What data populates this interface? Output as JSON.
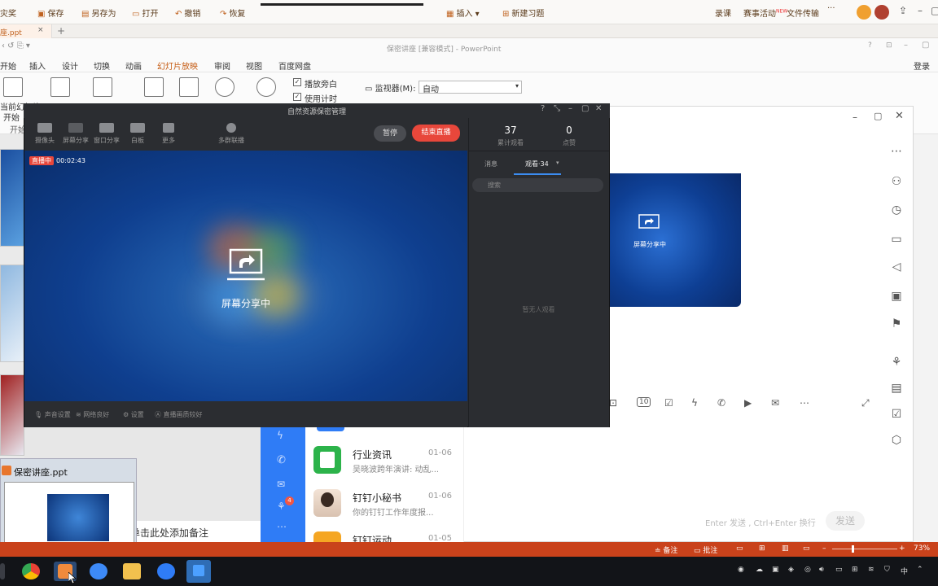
{
  "toolbar": {
    "left_cut": "灾奖",
    "save": "保存",
    "save_as": "另存为",
    "open": "打开",
    "undo": "撤销",
    "redo": "恢复",
    "insert": "插入",
    "new_exercise": "新建习题",
    "record": "录课",
    "events": "赛事活动",
    "events_badge": "NEW",
    "file_transfer": "文件传输",
    "more": "···"
  },
  "doc_tab": {
    "name": "座.ppt",
    "close": "×",
    "add": "+"
  },
  "window_title": "保密讲座 [兼容模式] - PowerPoint",
  "ribbon_tabs": [
    {
      "label": "开始"
    },
    {
      "label": "插入"
    },
    {
      "label": "设计"
    },
    {
      "label": "切换"
    },
    {
      "label": "动画"
    },
    {
      "label": "幻灯片放映"
    },
    {
      "label": "审阅"
    },
    {
      "label": "视图"
    },
    {
      "label": "百度网盘"
    }
  ],
  "login": "登录",
  "ribbon": {
    "from_current_1": "当前幻灯片",
    "from_current_2": "开始",
    "begin_cut": "开始",
    "play_narration": "播放旁白",
    "use_timing": "使用计时",
    "monitor_label": "监视器(M):",
    "monitor_value": "自动"
  },
  "live": {
    "title": "自然资源保密管理",
    "tools": [
      {
        "label": "摄像头"
      },
      {
        "label": "屏幕分享"
      },
      {
        "label": "窗口分享"
      },
      {
        "label": "白板"
      },
      {
        "label": "更多"
      },
      {
        "label": "多群联播"
      }
    ],
    "pause": "暂停",
    "end": "结束直播",
    "badge": "直播中",
    "elapsed": "00:02:43",
    "sharing": "屏幕分享中",
    "status": [
      {
        "label": "声音设置"
      },
      {
        "label": "网络良好"
      },
      {
        "label": "设置"
      },
      {
        "label": "直播画质较好"
      }
    ],
    "viewers_count": "37",
    "viewers_label": "累计观看",
    "likes_count": "0",
    "likes_label": "点赞",
    "tab_messages": "消息",
    "tab_audience": "观看·34",
    "search_placeholder": "搜索",
    "empty": "暂无人观看"
  },
  "dingtalk": {
    "preview_text": "屏幕分享中",
    "messages": [
      {
        "name": "行业资讯",
        "time": "01-06",
        "sub": "吴晓波跨年演讲: 动乱..."
      },
      {
        "name": "钉钉小秘书",
        "time": "01-06",
        "sub": "你的钉钉工作年度报..."
      },
      {
        "name": "钉钉运动",
        "time": "01-05",
        "sub": ""
      }
    ],
    "input_placeholder": "Enter 发送 , Ctrl+Enter 换行",
    "send": "发送",
    "badge": "4"
  },
  "thumbnail": {
    "caption": "保密讲座.ppt"
  },
  "notes_placeholder": "单击此处添加备注",
  "status_bar": {
    "notes": "备注",
    "comments": "批注",
    "zoom": "73%"
  },
  "taskbar": {
    "ime": "中"
  },
  "colors": {
    "accent": "#c55a11",
    "statusbar": "#c9421b",
    "live_end": "#e8473b",
    "dingtalk_blue": "#2f7cf6"
  }
}
